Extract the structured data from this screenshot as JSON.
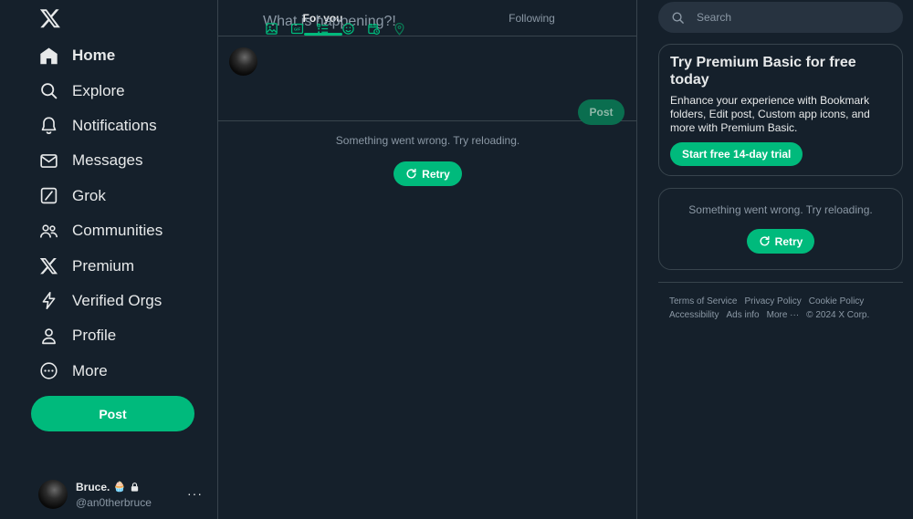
{
  "sidebar": {
    "logo": "x-logo-icon",
    "nav": [
      {
        "label": "Home",
        "icon": "home-icon",
        "active": true
      },
      {
        "label": "Explore",
        "icon": "search-icon"
      },
      {
        "label": "Notifications",
        "icon": "bell-icon"
      },
      {
        "label": "Messages",
        "icon": "envelope-icon"
      },
      {
        "label": "Grok",
        "icon": "grok-icon"
      },
      {
        "label": "Communities",
        "icon": "people-icon"
      },
      {
        "label": "Premium",
        "icon": "x-logo-icon"
      },
      {
        "label": "Verified Orgs",
        "icon": "lightning-icon"
      },
      {
        "label": "Profile",
        "icon": "person-icon"
      },
      {
        "label": "More",
        "icon": "more-circle-icon"
      }
    ],
    "post_label": "Post",
    "account": {
      "name": "Bruce.",
      "name_emoji": "🧁",
      "lock": "lock-icon",
      "handle": "@an0therbruce",
      "more": "···"
    }
  },
  "main": {
    "tabs": [
      {
        "label": "For you",
        "active": true
      },
      {
        "label": "Following",
        "active": false
      }
    ],
    "composer": {
      "placeholder": "What is happening?!",
      "post_label": "Post",
      "tools": [
        "image-icon",
        "gif-icon",
        "poll-icon",
        "emoji-icon",
        "schedule-icon",
        "location-icon"
      ]
    },
    "error": {
      "message": "Something went wrong. Try reloading.",
      "retry_label": "Retry"
    }
  },
  "right": {
    "search": {
      "placeholder": "Search"
    },
    "premium": {
      "title": "Try Premium Basic for free today",
      "description": "Enhance your experience with Bookmark folders, Edit post, Custom app icons, and more with Premium Basic.",
      "button": "Start free 14-day trial"
    },
    "error": {
      "message": "Something went wrong. Try reloading.",
      "retry_label": "Retry"
    },
    "footer": {
      "links": [
        "Terms of Service",
        "Privacy Policy",
        "Cookie Policy",
        "Accessibility",
        "Ads info",
        "More ···"
      ],
      "copyright": "© 2024 X Corp."
    }
  },
  "colors": {
    "background": "#15202b",
    "accent": "#00ba7c",
    "border": "#38444d",
    "muted_text": "#8b98a5"
  }
}
